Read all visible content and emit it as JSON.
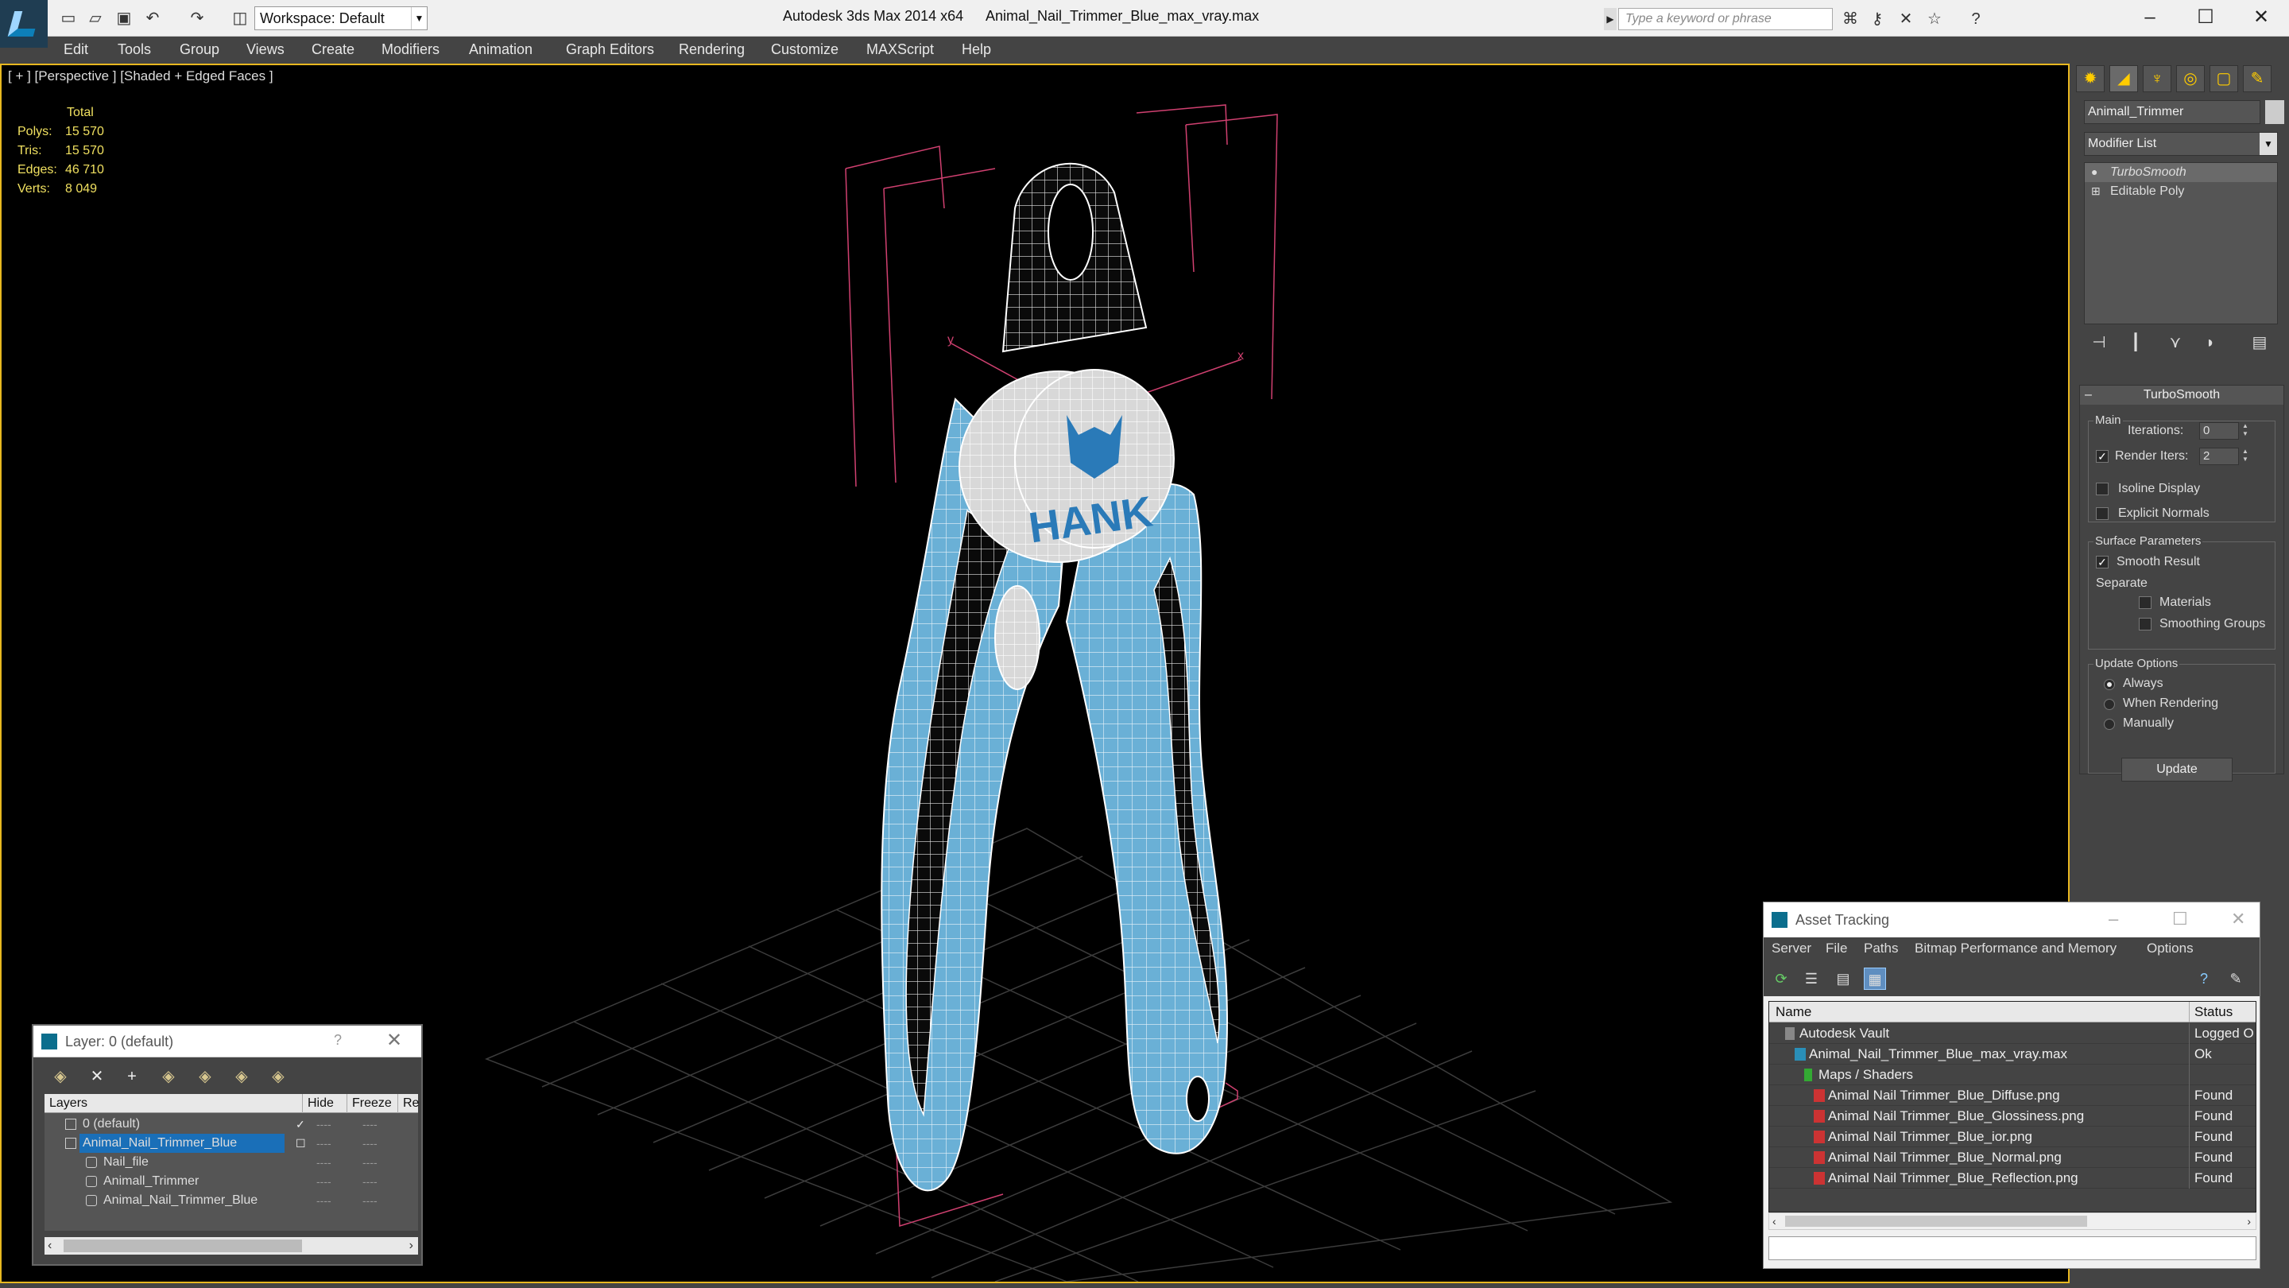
{
  "titlebar": {
    "workspace": "Workspace: Default",
    "app_title": "Autodesk 3ds Max  2014 x64",
    "file_title": "Animal_Nail_Trimmer_Blue_max_vray.max",
    "search_placeholder": "Type a keyword or phrase"
  },
  "menu": [
    "Edit",
    "Tools",
    "Group",
    "Views",
    "Create",
    "Modifiers",
    "Animation",
    "Graph Editors",
    "Rendering",
    "Customize",
    "MAXScript",
    "Help"
  ],
  "viewport": {
    "label": "[ + ] [Perspective ] [Shaded + Edged Faces ]",
    "stats_header": "Total",
    "stats": [
      {
        "label": "Polys:",
        "value": "15 570"
      },
      {
        "label": "Tris:",
        "value": "15 570"
      },
      {
        "label": "Edges:",
        "value": "46 710"
      },
      {
        "label": "Verts:",
        "value": "8 049"
      }
    ],
    "logo_text": "HANK",
    "gizmo_x": "x",
    "gizmo_y": "y"
  },
  "command_panel": {
    "object_name": "Animall_Trimmer",
    "modifier_list": "Modifier List",
    "stack": [
      "TurboSmooth",
      "Editable Poly"
    ],
    "rollout_title": "TurboSmooth",
    "main_group": "Main",
    "iterations_label": "Iterations:",
    "iterations_value": "0",
    "render_iters_label": "Render Iters:",
    "render_iters_value": "2",
    "isoline_display": "Isoline Display",
    "explicit_normals": "Explicit Normals",
    "surface_params": "Surface Parameters",
    "smooth_result": "Smooth Result",
    "separate": "Separate",
    "materials": "Materials",
    "smoothing_groups": "Smoothing Groups",
    "update_options": "Update Options",
    "always": "Always",
    "when_rendering": "When Rendering",
    "manually": "Manually",
    "update_button": "Update"
  },
  "layer_panel": {
    "title": "Layer: 0 (default)",
    "help": "?",
    "columns": [
      "Layers",
      "Hide",
      "Freeze",
      "Re"
    ],
    "rows": [
      {
        "name": "0 (default)",
        "indent": 0
      },
      {
        "name": "Animal_Nail_Trimmer_Blue",
        "indent": 0
      },
      {
        "name": "Nail_file",
        "indent": 1
      },
      {
        "name": "Animall_Trimmer",
        "indent": 1
      },
      {
        "name": "Animal_Nail_Trimmer_Blue",
        "indent": 1
      }
    ],
    "dash": "----"
  },
  "asset_panel": {
    "title": "Asset Tracking",
    "menu": [
      "Server",
      "File",
      "Paths",
      "Bitmap Performance and Memory",
      "Options"
    ],
    "columns": [
      "Name",
      "Status"
    ],
    "rows": [
      {
        "name": "Autodesk Vault",
        "status": "Logged O"
      },
      {
        "name": "Animal_Nail_Trimmer_Blue_max_vray.max",
        "status": "Ok"
      },
      {
        "name": "Maps / Shaders",
        "status": ""
      },
      {
        "name": "Animal Nail Trimmer_Blue_Diffuse.png",
        "status": "Found"
      },
      {
        "name": "Animal Nail Trimmer_Blue_Glossiness.png",
        "status": "Found"
      },
      {
        "name": "Animal Nail Trimmer_Blue_ior.png",
        "status": "Found"
      },
      {
        "name": "Animal Nail Trimmer_Blue_Normal.png",
        "status": "Found"
      },
      {
        "name": "Animal Nail Trimmer_Blue_Reflection.png",
        "status": "Found"
      }
    ]
  },
  "colors": {
    "viewport_border": "#e8b820",
    "model_blue": "#6ab0d6",
    "selection_blue": "#1a6fb8",
    "stats_yellow": "#f0e060"
  }
}
